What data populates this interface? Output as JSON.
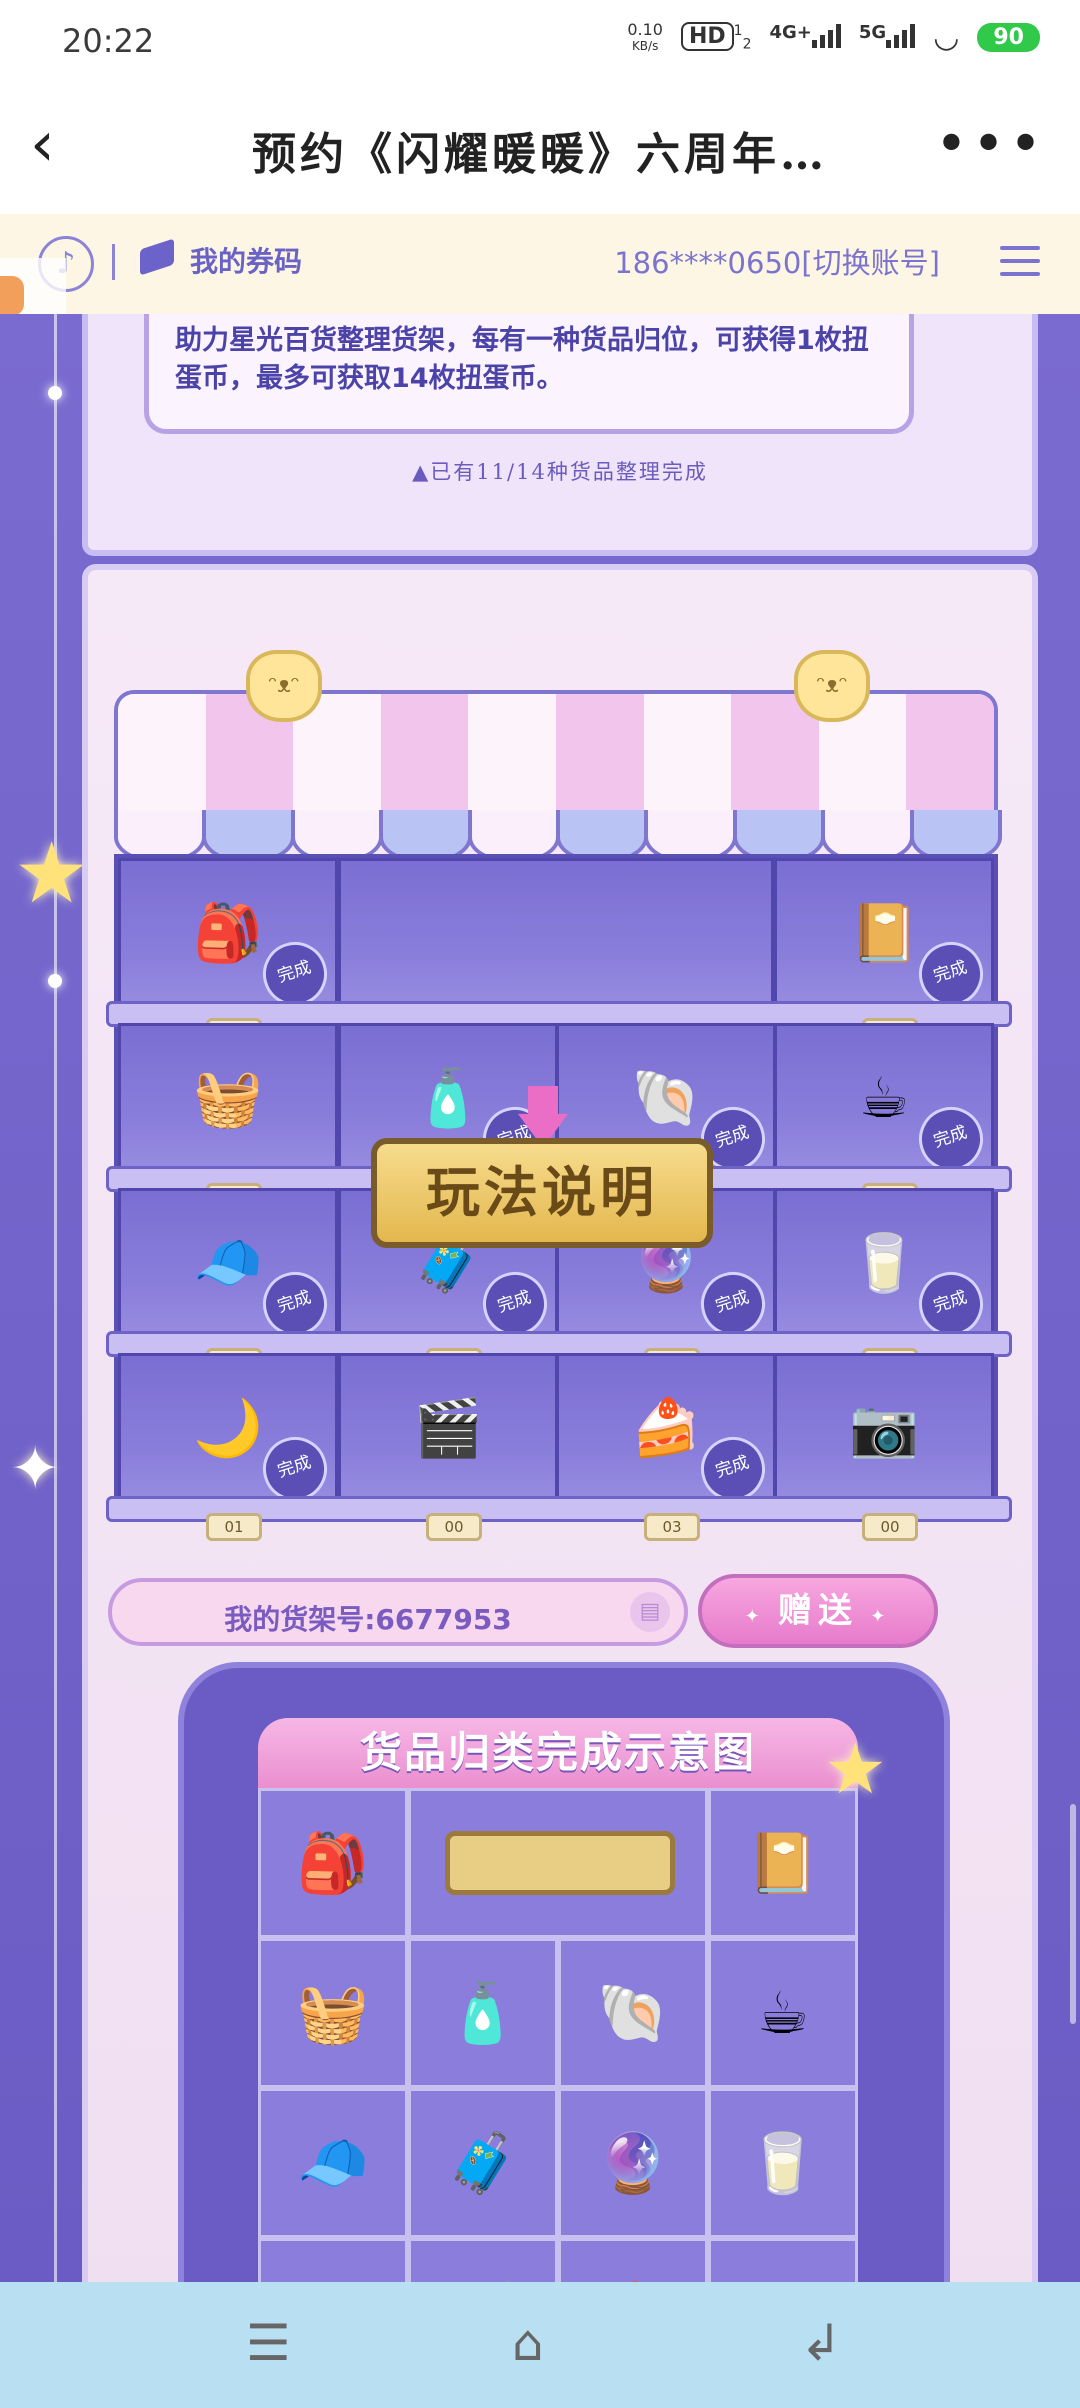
{
  "status_bar": {
    "time": "20:22",
    "net_speed": "0.10",
    "net_unit": "KB/s",
    "hd": "HD",
    "hd_sub": "1",
    "hd_sub2": "2",
    "net1": "4G+",
    "net2": "5G",
    "battery": "90"
  },
  "title_bar": {
    "title": "预约《闪耀暖暖》六周年…"
  },
  "toolbar": {
    "my_codes": "我的券码",
    "account": "186****0650[切换账号]"
  },
  "intro": {
    "text": "助力星光百货整理货架，每有一种货品归位，可获得1枚扭蛋币，最多可获取14枚扭蛋币。",
    "progress": "▲已有11/14种货品整理完成"
  },
  "shelf": {
    "rules_button": "玩法说明",
    "done_label": "完成",
    "rows": [
      {
        "items": [
          {
            "icon": "🎒",
            "count": "02",
            "done": true
          },
          null,
          null,
          {
            "icon": "📔",
            "count": "01",
            "done": true
          }
        ]
      },
      {
        "items": [
          {
            "icon": "🧺",
            "count": "00",
            "done": false
          },
          {
            "icon": "🧴",
            "count": "01",
            "done": true
          },
          {
            "icon": "🐚",
            "count": "01",
            "done": true
          },
          {
            "icon": "☕",
            "count": "01",
            "done": true
          }
        ]
      },
      {
        "items": [
          {
            "icon": "🧢",
            "count": "01",
            "done": true
          },
          {
            "icon": "🧳",
            "count": "01",
            "done": true
          },
          {
            "icon": "🔮",
            "count": "01",
            "done": true
          },
          {
            "icon": "🥛",
            "count": "01",
            "done": true
          }
        ]
      },
      {
        "items": [
          {
            "icon": "🌙",
            "count": "01",
            "done": true
          },
          {
            "icon": "🎬",
            "count": "00",
            "done": false
          },
          {
            "icon": "🍰",
            "count": "03",
            "done": true
          },
          {
            "icon": "📷",
            "count": "00",
            "done": false
          }
        ]
      }
    ]
  },
  "shelf_number": {
    "label": "我的货架号:6677953"
  },
  "gift_button": "赠送",
  "diagram": {
    "title": "货品归类完成示意图",
    "items": [
      "🎒",
      "📔",
      "🧺",
      "🧴",
      "🐚",
      "☕",
      "🧢",
      "🧳",
      "🔮",
      "🥛",
      "🌙",
      "🎬",
      "🍰",
      "📷"
    ]
  }
}
